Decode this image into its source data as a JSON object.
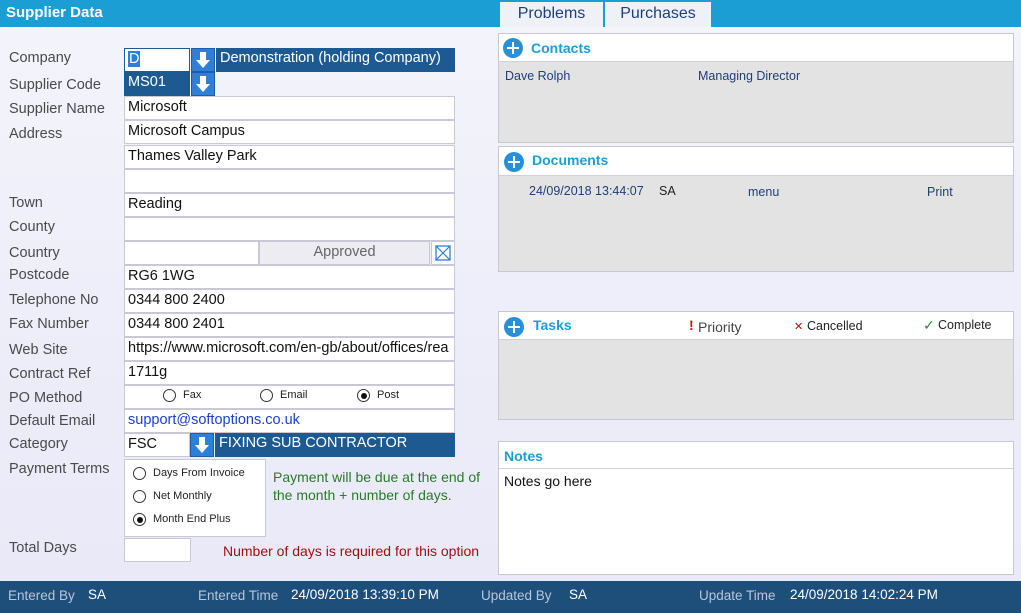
{
  "header": {
    "title": "Supplier Data"
  },
  "tabs": [
    {
      "label": "Problems"
    },
    {
      "label": "Purchases"
    }
  ],
  "labels": {
    "company": "Company",
    "supplier_code": "Supplier Code",
    "supplier_name": "Supplier Name",
    "address": "Address",
    "town": "Town",
    "county": "County",
    "country": "Country",
    "postcode": "Postcode",
    "telephone": "Telephone No",
    "fax": "Fax Number",
    "website": "Web Site",
    "contract_ref": "Contract Ref",
    "po_method": "PO Method",
    "default_email": "Default Email",
    "category": "Category",
    "payment_terms": "Payment Terms",
    "total_days": "Total Days"
  },
  "fields": {
    "company_code": "D",
    "company_desc": "Demonstration (holding Company)",
    "supplier_code": "MS01",
    "supplier_name": "Microsoft",
    "address_1": "Microsoft Campus",
    "address_2": "Thames Valley Park",
    "address_3": "",
    "town": "Reading",
    "county": "",
    "country": "",
    "approved": "Approved",
    "postcode": "RG6 1WG",
    "telephone": "0344 800 2400",
    "fax": "0344 800 2401",
    "website": "https://www.microsoft.com/en-gb/about/offices/rea",
    "contract_ref": "1711g",
    "default_email": "support@softoptions.co.uk",
    "category_code": "FSC",
    "category_desc": "FIXING SUB CONTRACTOR",
    "total_days": ""
  },
  "po_method": {
    "options": [
      "Fax",
      "Email",
      "Post"
    ],
    "selected": "Post"
  },
  "payment_terms": {
    "options": [
      "Days From Invoice",
      "Net Monthly",
      "Month End Plus"
    ],
    "selected": "Month End Plus",
    "hint": "Payment will be due at the end of the month + number of days.",
    "hint_color": "#2a7a2a"
  },
  "total_days_warning": "Number of days is required for this option",
  "total_days_warning_color": "#a01010",
  "contacts": {
    "title": "Contacts",
    "rows": [
      {
        "name": "Dave Rolph",
        "role": "Managing Director"
      }
    ]
  },
  "documents": {
    "title": "Documents",
    "rows": [
      {
        "date": "24/09/2018 13:44:07",
        "user": "SA",
        "menu": "menu",
        "print": "Print"
      }
    ]
  },
  "tasks": {
    "title": "Tasks",
    "priority": "Priority",
    "cancelled": "Cancelled",
    "complete": "Complete"
  },
  "notes": {
    "title": "Notes",
    "text": "Notes go here"
  },
  "footer": {
    "entered_by_label": "Entered By",
    "entered_by": "SA",
    "entered_time_label": "Entered Time",
    "entered_time": "24/09/2018 13:39:10 PM",
    "updated_by_label": "Updated By",
    "updated_by": "SA",
    "update_time_label": "Update Time",
    "update_time": "24/09/2018 14:02:24 PM"
  },
  "colors": {
    "header_bg": "#1a9ed4",
    "footer_bg": "#1e4f7a",
    "combo_desc_bg": "#1e5a92",
    "accent": "#2a8fd6"
  }
}
